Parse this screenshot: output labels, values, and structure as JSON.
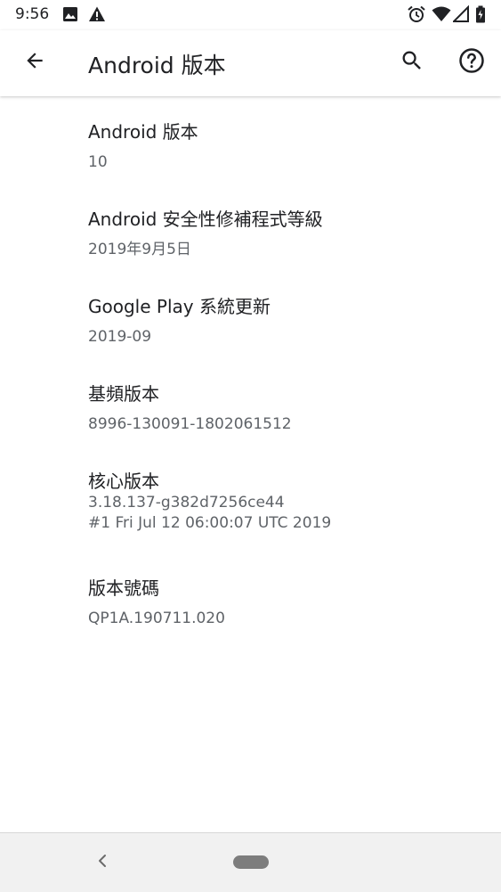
{
  "status_bar": {
    "time": "9:56",
    "icons": [
      "image-icon",
      "warning-icon",
      "alarm-icon",
      "wifi-icon",
      "signal-icon",
      "battery-icon"
    ]
  },
  "app_bar": {
    "title": "Android 版本",
    "back_icon": "arrow-back-icon",
    "search_icon": "search-icon",
    "help_icon": "help-icon"
  },
  "items": [
    {
      "title": "Android 版本",
      "summary": "10"
    },
    {
      "title": "Android 安全性修補程式等級",
      "summary": "2019年9月5日"
    },
    {
      "title": "Google Play 系統更新",
      "summary": "2019-09"
    },
    {
      "title": "基頻版本",
      "summary": "8996-130091-1802061512"
    },
    {
      "title": "核心版本",
      "summary_line1": "3.18.137-g382d7256ce44",
      "summary_line2": "#1 Fri Jul 12 06:00:07 UTC 2019"
    },
    {
      "title": "版本號碼",
      "summary": "QP1A.190711.020"
    }
  ],
  "colors": {
    "text_primary": "#202124",
    "text_secondary": "#5f6368",
    "nav_bar": "#f1f1f1"
  }
}
